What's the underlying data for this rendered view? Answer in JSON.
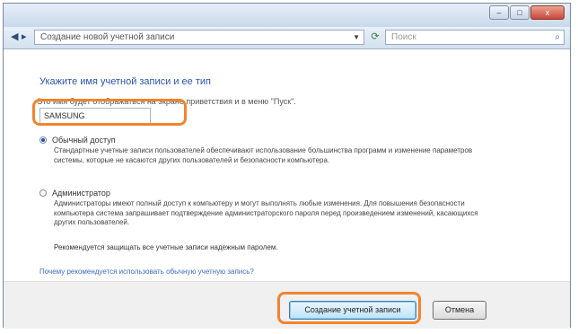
{
  "titlebar": {
    "buttons": [
      "–",
      "□",
      "x"
    ]
  },
  "address": {
    "path": "Создание новой учетной записи",
    "search_placeholder": "Поиск"
  },
  "content": {
    "heading": "Укажите имя учетной записи и ее тип",
    "hint": "Это имя будет отображаться на экране приветствия и в меню \"Пуск\".",
    "name_value": "SAMSUNG",
    "options": [
      {
        "label": "Обычный доступ",
        "selected": true,
        "description": "Стандартные учетные записи пользователей обеспечивают использование большинства программ и изменение параметров системы, которые не касаются других пользователей и безопасности компьютера."
      },
      {
        "label": "Администратор",
        "selected": false,
        "description": "Администраторы имеют полный доступ к компьютеру и могут выполнять любые изменения. Для повышения безопасности компьютера система запрашивает подтверждение администраторского пароля перед произведением изменений, касающихся других пользователей."
      }
    ],
    "recommendation": "Рекомендуется защищать все учетные записи надежным паролем.",
    "link": "Почему рекомендуется использовать обычную учетную запись?"
  },
  "footer": {
    "create_label": "Создание учетной записи",
    "cancel_label": "Отмена"
  },
  "colors": {
    "highlight": "#f0852f",
    "heading": "#2a56a8",
    "link": "#3a6ec2"
  },
  "icons": [
    "back-icon",
    "forward-icon",
    "refresh-icon",
    "search-icon",
    "minimize-icon",
    "maximize-icon",
    "close-icon"
  ]
}
